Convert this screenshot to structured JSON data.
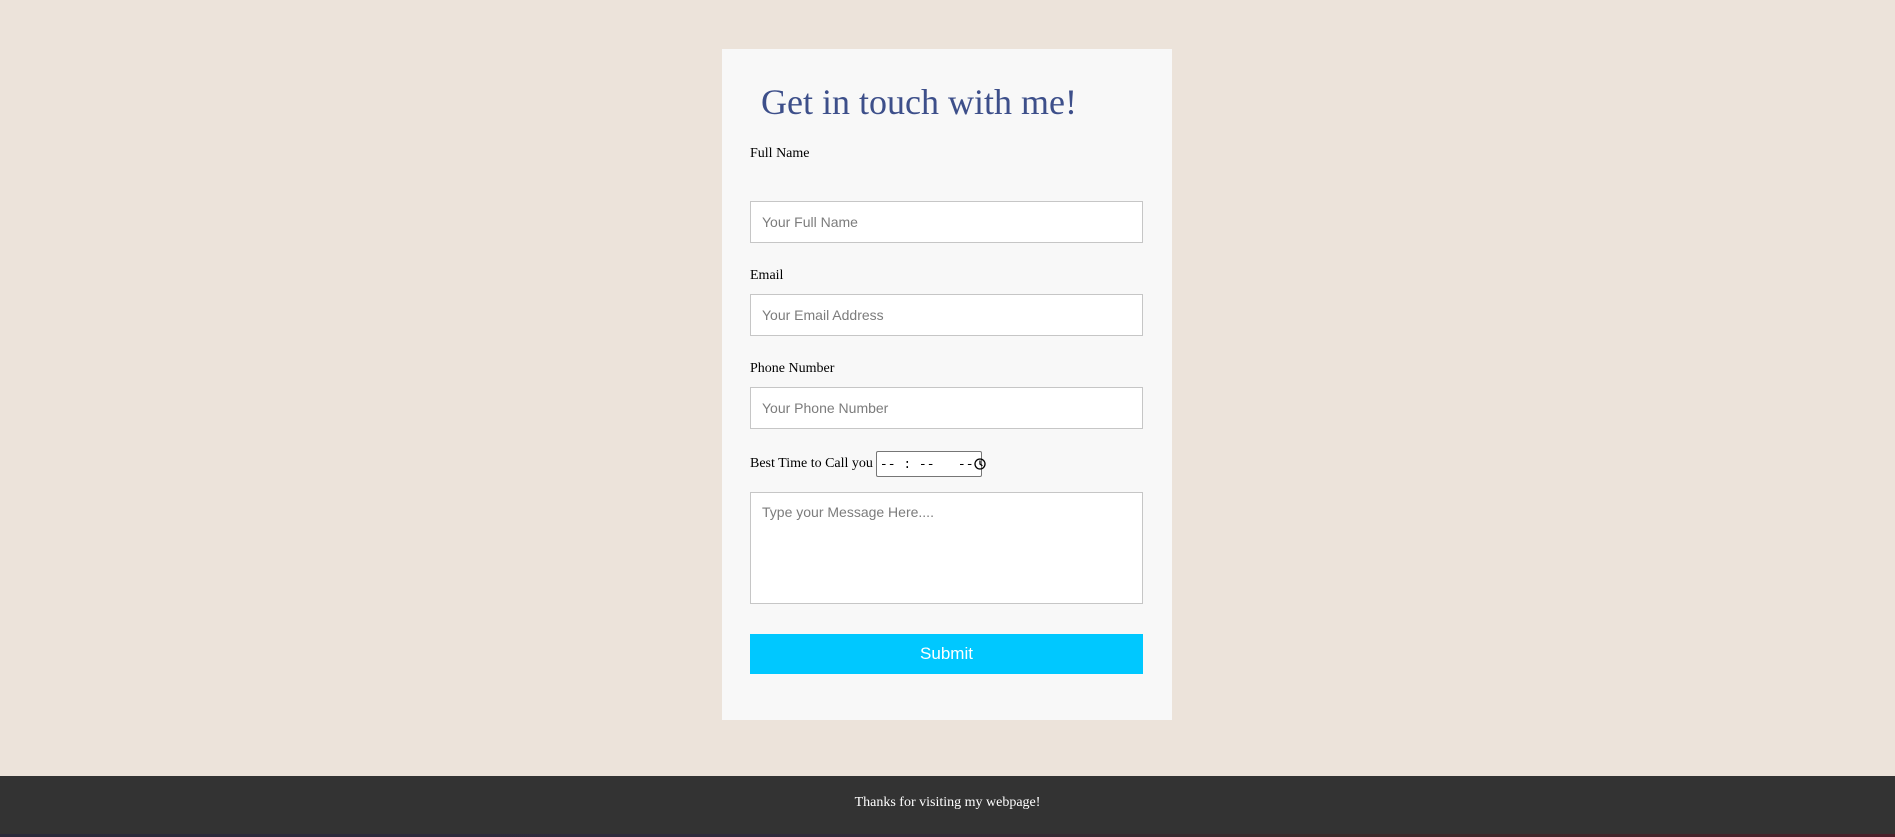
{
  "contact_form": {
    "title": "Get in touch with me!",
    "full_name": {
      "label": "Full Name",
      "placeholder": "Your Full Name",
      "value": ""
    },
    "email": {
      "label": "Email",
      "placeholder": "Your Email Address",
      "value": ""
    },
    "phone": {
      "label": "Phone Number",
      "placeholder": "Your Phone Number",
      "value": ""
    },
    "best_time": {
      "label": "Best Time to Call you",
      "display": "-- : --   --",
      "icon": "clock-icon"
    },
    "message": {
      "placeholder": "Type your Message Here...."
    },
    "submit_label": "Submit"
  },
  "footer": {
    "text": "Thanks for visiting my webpage!"
  },
  "colors": {
    "page_background": "#ece3da",
    "card_background": "#f8f8f8",
    "title_color": "#3d4f8a",
    "submit_background": "#00c8ff",
    "footer_background": "#333333"
  }
}
